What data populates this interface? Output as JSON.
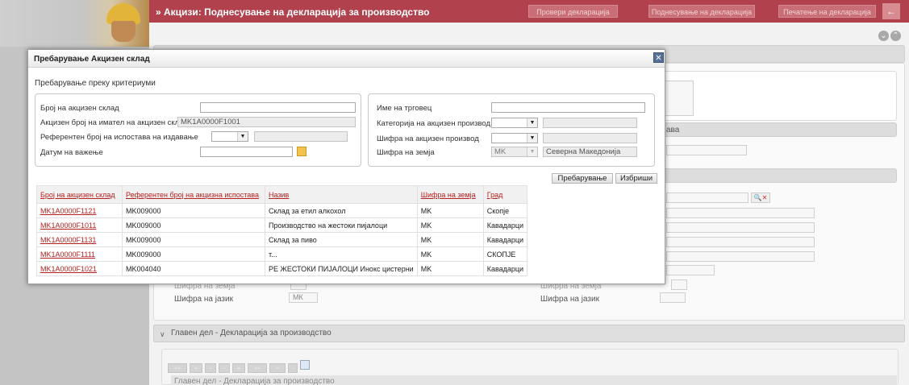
{
  "app": {
    "title": "» Акцизи: Поднесување на декларација за производство",
    "buttons": [
      "Провери декларација",
      "Поднесување на декларација",
      "Печатење на декларација"
    ],
    "back_icon": "back-arrow-icon"
  },
  "background": {
    "section_title": "Главен дел - Декларација за производство",
    "grid_subtitle": "Главен дел - Декларација за производство",
    "field_partial_label": "Шифра на земја",
    "language_label": "Шифра на јазик",
    "language_value_left": "МК",
    "header_fragment": "ава"
  },
  "modal": {
    "title": "Пребарување Акцизен склад",
    "criteria_label": "Пребарување преку критериуми",
    "left_fields": {
      "warehouse_no_label": "Број на акцизен склад",
      "warehouse_no_value": "",
      "holder_no_label": "Акцизен број на имател на акцизен склад",
      "holder_no_value": "MK1A0000F1001",
      "ref_no_label": "Референтен број на испостава на издавање",
      "valid_date_label": "Датум на важење",
      "valid_date_value": ""
    },
    "right_fields": {
      "trader_label": "Име на трговец",
      "trader_value": "",
      "category_label": "Категорија на акцизен производ",
      "product_code_label": "Шифра на акцизен производ",
      "country_label": "Шифра на земја",
      "country_code": "MK",
      "country_name": "Северна Македонија"
    },
    "search_button": "Пребарување",
    "clear_button": "Избриши",
    "table": {
      "headers": [
        "Број на акцизен склад",
        "Референтен број на акцизна испостава",
        "Назив",
        "Шифра на земја",
        "Град"
      ],
      "rows": [
        [
          "MK1A0000F1121",
          "MK009000",
          "Склад за етил алкохол",
          "MK",
          "Скопје"
        ],
        [
          "MK1A0000F1011",
          "MK009000",
          "Производство на жестоки пијалоци",
          "MK",
          "Кавадарци"
        ],
        [
          "MK1A0000F1131",
          "MK009000",
          "Склад за пиво",
          "MK",
          "Кавадарци"
        ],
        [
          "MK1A0000F1111",
          "MK009000",
          "т...",
          "MK",
          "СКОПЈЕ"
        ],
        [
          "MK1A0000F1021",
          "MK004040",
          "РЕ ЖЕСТОКИ ПИЈАЛОЦИ Инокс цистерни",
          "MK",
          "Кавадарци"
        ]
      ]
    }
  }
}
